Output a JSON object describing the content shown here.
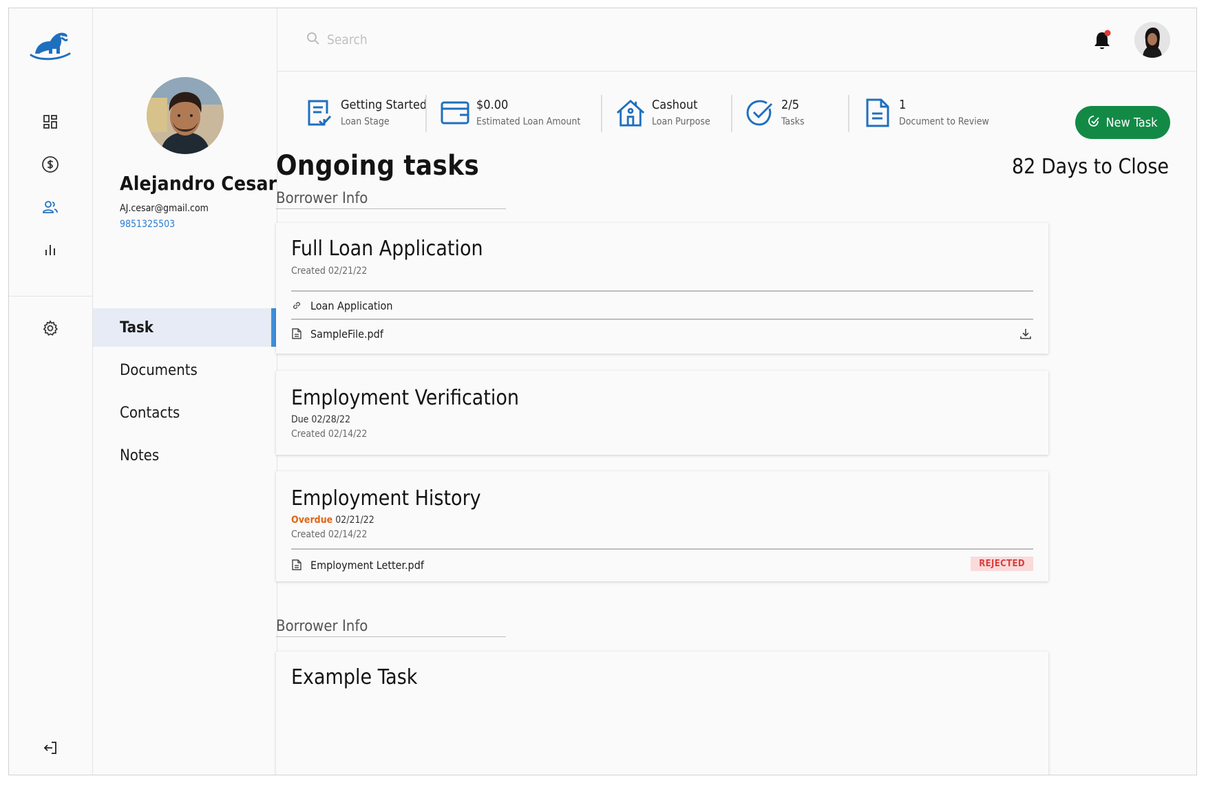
{
  "brand": {
    "logo_icon": "elephant-logo",
    "brand_color": "#1f6fbf"
  },
  "rail": {
    "items": [
      {
        "icon": "dashboard-icon"
      },
      {
        "icon": "dollar-icon"
      },
      {
        "icon": "users-icon"
      },
      {
        "icon": "bar-chart-icon"
      },
      {
        "icon": "gear-icon"
      }
    ],
    "logout_icon": "logout-icon"
  },
  "profile": {
    "name": "Alejandro Cesar",
    "email": "AJ.cesar@gmail.com",
    "phone": "9851325503"
  },
  "menu": {
    "items": [
      {
        "label": "Task",
        "active": true
      },
      {
        "label": "Documents",
        "active": false
      },
      {
        "label": "Contacts",
        "active": false
      },
      {
        "label": "Notes",
        "active": false
      }
    ]
  },
  "topbar": {
    "search_placeholder": "Search",
    "notification_dot_color": "#e53935"
  },
  "stats": [
    {
      "value": "Getting Started",
      "label": "Loan Stage",
      "icon": "checklist-doc-icon"
    },
    {
      "value": "$0.00",
      "label": "Estimated Loan Amount",
      "icon": "wallet-icon"
    },
    {
      "value": "Cashout",
      "label": "Loan Purpose",
      "icon": "house-icon"
    },
    {
      "value": "2/5",
      "label": "Tasks",
      "icon": "check-circle-icon"
    },
    {
      "value": "1",
      "label": "Document to Review",
      "icon": "document-icon"
    }
  ],
  "new_task_label": "New Task",
  "main": {
    "heading": "Ongoing tasks",
    "days_to_close": "82 Days to Close",
    "sections": [
      {
        "label": "Borrower Info"
      },
      {
        "label": "Borrower Info"
      }
    ],
    "tasks": [
      {
        "title": "Full Loan Application",
        "created": "Created 02/21/22",
        "link": "Loan Application",
        "file": "SampleFile.pdf"
      },
      {
        "title": "Employment Verification",
        "due": "Due 02/28/22",
        "created": "Created 02/14/22"
      },
      {
        "title": "Employment History",
        "overdue_label": "Overdue",
        "overdue_date": "02/21/22",
        "created": "Created 02/14/22",
        "file": "Employment Letter.pdf",
        "status": "REJECTED"
      },
      {
        "title": "Example Task"
      }
    ]
  }
}
